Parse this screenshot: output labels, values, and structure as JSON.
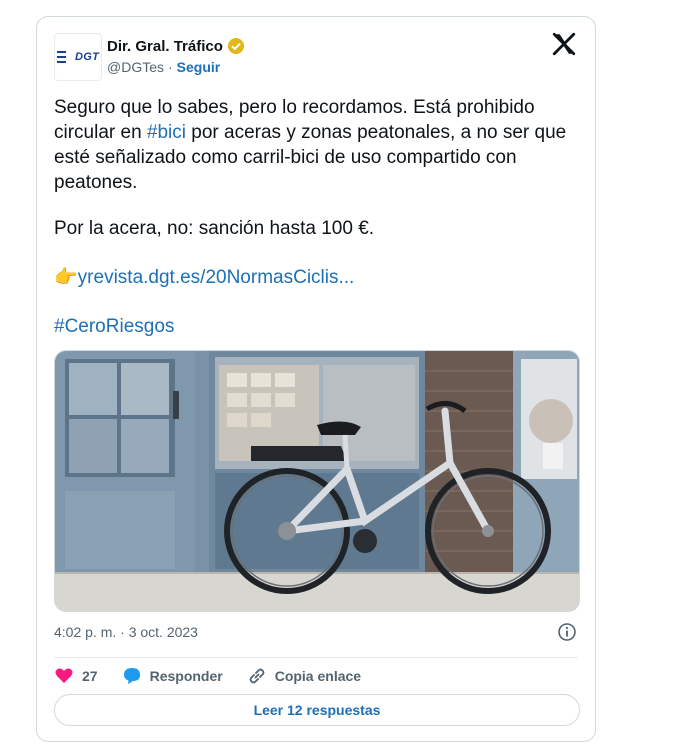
{
  "account": {
    "name": "Dir. Gral. Tráfico",
    "handle": "@DGTes",
    "separator": "·",
    "follow_label": "Seguir",
    "logo_text": "DGT"
  },
  "tweet": {
    "paragraph1_before": "Seguro que lo sabes, pero lo recordamos. Está prohibido circular en ",
    "hashtag_bici": "#bici",
    "paragraph1_after": " por aceras y zonas peatonales, a no ser que esté señalizado como carril-bici de uso compartido con peatones.",
    "paragraph2": "Por la acera, no: sanción hasta 100 €.",
    "link_emoji": "👉",
    "link_text": "yrevista.dgt.es/20NormasCiclis...",
    "hashtag2": "#CeroRiesgos"
  },
  "timestamp": "4:02 p. m. · 3 oct. 2023",
  "actions": {
    "like_count": "27",
    "reply_label": "Responder",
    "copy_label": "Copia enlace"
  },
  "read_replies_label": "Leer 12 respuestas",
  "colors": {
    "link": "#1d6fb8",
    "like": "#f91880",
    "verified": "#e2b719"
  }
}
